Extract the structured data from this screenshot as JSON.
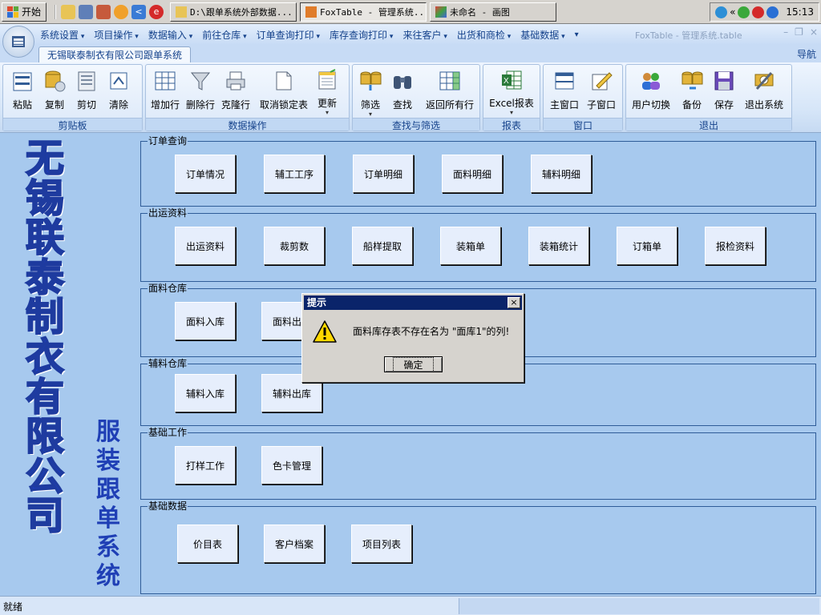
{
  "taskbar": {
    "start_label": "开始",
    "quick_launch": [
      "folder-icon",
      "disk-icon",
      "chart-icon",
      "smiley-icon",
      "arrow-icon",
      "antivirus-icon"
    ],
    "tasks": [
      {
        "label": "D:\\跟单系统外部数据...",
        "icon": "folder-icon",
        "active": false
      },
      {
        "label": "FoxTable - 管理系统...",
        "icon": "foxtable-icon",
        "active": true
      },
      {
        "label": "未命名 - 画图",
        "icon": "paint-icon",
        "active": false
      }
    ],
    "tray_chevron": "«",
    "clock": "15:13"
  },
  "menubar": {
    "items": [
      "系统设置",
      "项目操作",
      "数据输入",
      "前往仓库",
      "订单查询打印",
      "库存查询打印",
      "来往客户",
      "出货和商检",
      "基础数据"
    ],
    "more": "▾",
    "window_title": "FoxTable - 管理系统.table",
    "window_controls": [
      "–",
      "❐",
      "×"
    ]
  },
  "tabs": {
    "main": "无锡联泰制衣有限公司跟单系统",
    "nav": "导航"
  },
  "ribbon": {
    "groups": [
      {
        "label": "剪贴板",
        "buttons": [
          "粘贴",
          "复制",
          "剪切",
          "清除"
        ]
      },
      {
        "label": "数据操作",
        "buttons": [
          "增加行",
          "删除行",
          "克隆行",
          "取消锁定表",
          "更新"
        ]
      },
      {
        "label": "查找与筛选",
        "buttons": [
          "筛选",
          "查找",
          "返回所有行"
        ]
      },
      {
        "label": "报表",
        "buttons": [
          "Excel报表"
        ]
      },
      {
        "label": "窗口",
        "buttons": [
          "主窗口",
          "子窗口"
        ]
      },
      {
        "label": "退出",
        "buttons": [
          "用户切换",
          "备份",
          "保存",
          "退出系统"
        ]
      }
    ]
  },
  "brand": {
    "title_chars": [
      "无",
      "锡",
      "联",
      "泰",
      "制",
      "衣",
      "有",
      "限",
      "公",
      "司"
    ],
    "subtitle_chars": [
      "服",
      "装",
      "跟",
      "单",
      "系",
      "统"
    ]
  },
  "sections": [
    {
      "title": "订单查询",
      "buttons": [
        "订单情况",
        "辅工工序",
        "订单明细",
        "面料明细",
        "辅料明细"
      ]
    },
    {
      "title": "出运资料",
      "buttons": [
        "出运资料",
        "裁剪数",
        "船样提取",
        "装箱单",
        "装箱统计",
        "订箱单",
        "报检资料"
      ]
    },
    {
      "title": "面料仓库",
      "buttons": [
        "面料入库",
        "面料出库"
      ]
    },
    {
      "title": "辅料仓库",
      "buttons": [
        "辅料入库",
        "辅料出库"
      ]
    },
    {
      "title": "基础工作",
      "buttons": [
        "打样工作",
        "色卡管理"
      ]
    },
    {
      "title": "基础数据",
      "buttons": [
        "价目表",
        "客户档案",
        "项目列表"
      ]
    }
  ],
  "dialog": {
    "title": "提示",
    "close": "×",
    "message": "面料库存表不存在名为 \"面库1\"的列!",
    "ok_label": "确定",
    "icon": "warning-icon"
  },
  "status": {
    "text": "就绪"
  }
}
